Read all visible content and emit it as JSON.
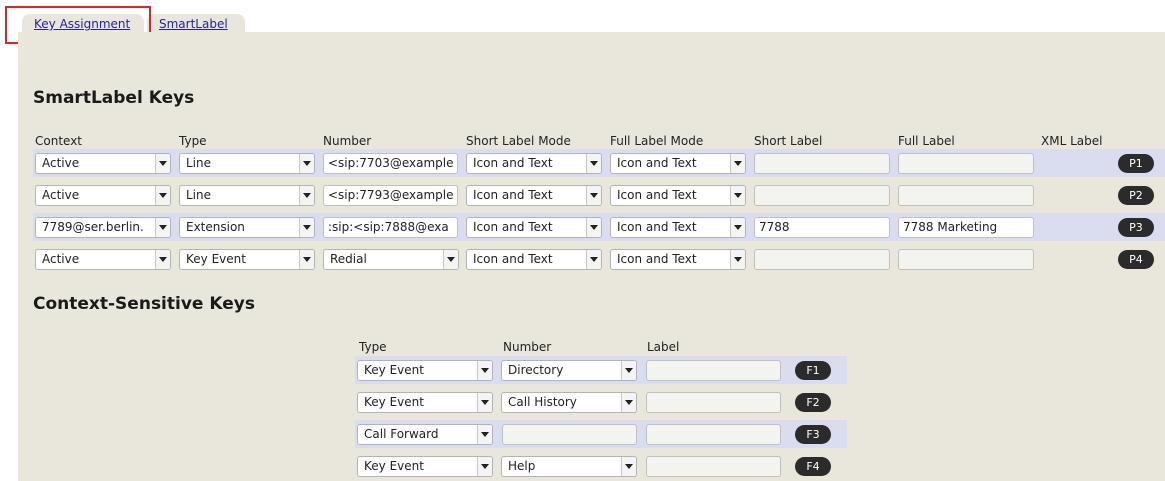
{
  "tabs": [
    {
      "label": "Key Assignment"
    },
    {
      "label": "SmartLabel"
    }
  ],
  "smartlabel": {
    "title": "SmartLabel Keys",
    "headers": {
      "context": "Context",
      "type": "Type",
      "number": "Number",
      "short_mode": "Short Label Mode",
      "full_mode": "Full Label Mode",
      "short_label": "Short Label",
      "full_label": "Full Label",
      "xml_label": "XML Label"
    },
    "rows": [
      {
        "context": "Active",
        "type": "Line",
        "number": "<sip:7703@example",
        "short_mode": "Icon and Text",
        "full_mode": "Icon and Text",
        "short_label": "",
        "full_label": "",
        "key": "P1"
      },
      {
        "context": "Active",
        "type": "Line",
        "number": "<sip:7793@example",
        "short_mode": "Icon and Text",
        "full_mode": "Icon and Text",
        "short_label": "",
        "full_label": "",
        "key": "P2"
      },
      {
        "context": "7789@ser.berlin.",
        "type": "Extension",
        "number": ":sip:<sip:7888@exa",
        "short_mode": "Icon and Text",
        "full_mode": "Icon and Text",
        "short_label": "7788",
        "full_label": "7788 Marketing",
        "key": "P3"
      },
      {
        "context": "Active",
        "type": "Key Event",
        "number": "Redial",
        "short_mode": "Icon and Text",
        "full_mode": "Icon and Text",
        "short_label": "",
        "full_label": "",
        "key": "P4"
      }
    ]
  },
  "context_keys": {
    "title": "Context-Sensitive Keys",
    "headers": {
      "type": "Type",
      "number": "Number",
      "label": "Label"
    },
    "rows": [
      {
        "type": "Key Event",
        "number": "Directory",
        "label": "",
        "key": "F1"
      },
      {
        "type": "Key Event",
        "number": "Call History",
        "label": "",
        "key": "F2"
      },
      {
        "type": "Call Forward",
        "number": "",
        "label": "",
        "key": "F3"
      },
      {
        "type": "Key Event",
        "number": "Help",
        "label": "",
        "key": "F4"
      }
    ]
  },
  "colors": {
    "panel": "#e9e7dc",
    "row_highlight": "#d9ddef",
    "key_pill": "#2b2b2b",
    "focus_outline": "#d9262a",
    "link": "#2222aa"
  }
}
